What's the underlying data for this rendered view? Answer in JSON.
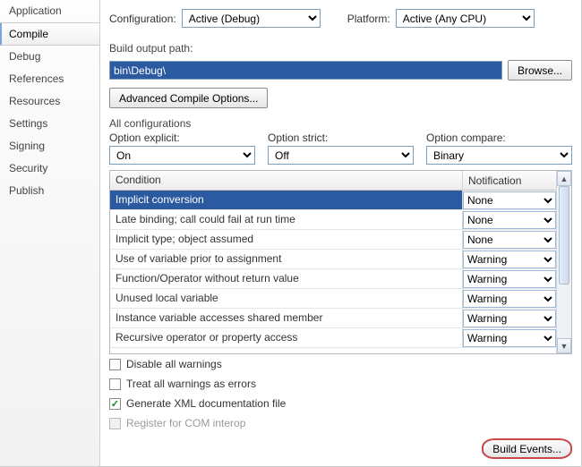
{
  "sidebar": {
    "items": [
      {
        "label": "Application"
      },
      {
        "label": "Compile"
      },
      {
        "label": "Debug"
      },
      {
        "label": "References"
      },
      {
        "label": "Resources"
      },
      {
        "label": "Settings"
      },
      {
        "label": "Signing"
      },
      {
        "label": "Security"
      },
      {
        "label": "Publish"
      }
    ],
    "selected_index": 1
  },
  "top": {
    "configuration_label": "Configuration:",
    "configuration_value": "Active (Debug)",
    "platform_label": "Platform:",
    "platform_value": "Active (Any CPU)"
  },
  "build": {
    "path_label": "Build output path:",
    "path_value": "bin\\Debug\\",
    "browse_label": "Browse...",
    "advanced_label": "Advanced Compile Options..."
  },
  "all_config_label": "All configurations",
  "options": {
    "explicit_label": "Option explicit:",
    "explicit_value": "On",
    "strict_label": "Option strict:",
    "strict_value": "Off",
    "compare_label": "Option compare:",
    "compare_value": "Binary"
  },
  "grid": {
    "header_condition": "Condition",
    "header_notification": "Notification",
    "rows": [
      {
        "condition": "Implicit conversion",
        "notification": "None"
      },
      {
        "condition": "Late binding; call could fail at run time",
        "notification": "None"
      },
      {
        "condition": "Implicit type; object assumed",
        "notification": "None"
      },
      {
        "condition": "Use of variable prior to assignment",
        "notification": "Warning"
      },
      {
        "condition": "Function/Operator without return value",
        "notification": "Warning"
      },
      {
        "condition": "Unused local variable",
        "notification": "Warning"
      },
      {
        "condition": "Instance variable accesses shared member",
        "notification": "Warning"
      },
      {
        "condition": "Recursive operator or property access",
        "notification": "Warning"
      }
    ],
    "selected_row_index": 0
  },
  "checks": {
    "disable_all": {
      "label": "Disable all warnings",
      "checked": false
    },
    "treat_as_errors": {
      "label": "Treat all warnings as errors",
      "checked": false
    },
    "gen_xml": {
      "label": "Generate XML documentation file",
      "checked": true
    },
    "register_com": {
      "label": "Register for COM interop",
      "checked": false,
      "disabled": true
    }
  },
  "footer": {
    "build_events_label": "Build Events..."
  }
}
